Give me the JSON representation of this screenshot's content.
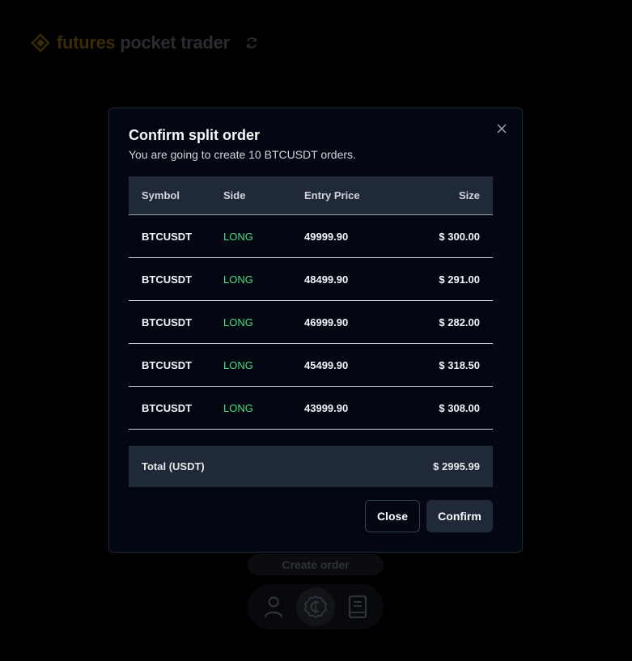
{
  "app": {
    "title_part1": "futures",
    "title_part2": "pocket trader"
  },
  "background": {
    "create_order_label": "Create order",
    "nav": [
      {
        "icon": "user-icon"
      },
      {
        "icon": "coin-icon",
        "active": true
      },
      {
        "icon": "book-icon"
      }
    ]
  },
  "modal": {
    "title": "Confirm split order",
    "description": "You are going to create 10 BTCUSDT orders.",
    "table": {
      "headers": [
        "Symbol",
        "Side",
        "Entry Price",
        "Size"
      ],
      "rows": [
        {
          "symbol": "BTCUSDT",
          "side": "LONG",
          "entry_price": "49999.90",
          "size": "$ 300.00"
        },
        {
          "symbol": "BTCUSDT",
          "side": "LONG",
          "entry_price": "48499.90",
          "size": "$ 291.00"
        },
        {
          "symbol": "BTCUSDT",
          "side": "LONG",
          "entry_price": "46999.90",
          "size": "$ 282.00"
        },
        {
          "symbol": "BTCUSDT",
          "side": "LONG",
          "entry_price": "45499.90",
          "size": "$ 318.50"
        },
        {
          "symbol": "BTCUSDT",
          "side": "LONG",
          "entry_price": "43999.90",
          "size": "$ 308.00"
        }
      ]
    },
    "total": {
      "label": "Total (USDT)",
      "value": "$ 2995.99"
    },
    "buttons": {
      "close_label": "Close",
      "confirm_label": "Confirm"
    }
  },
  "colors": {
    "accent_long": "#4ade80",
    "modal_bg": "#030712",
    "header_bg": "#1f2937",
    "logo_gold": "#b8860b"
  }
}
